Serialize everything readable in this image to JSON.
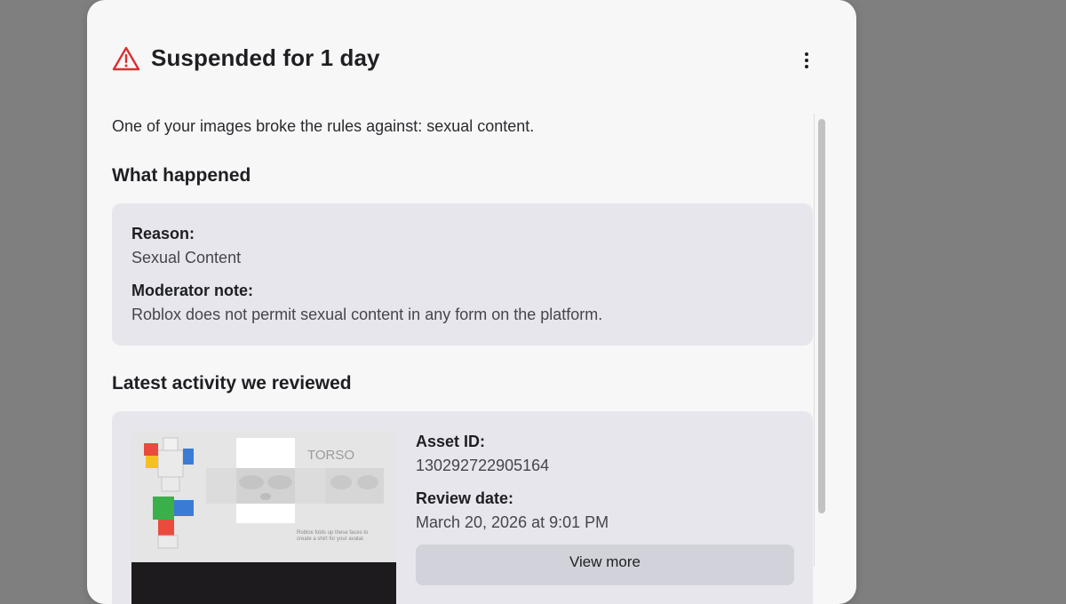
{
  "header": {
    "title": "Suspended for 1 day",
    "icon": "warning-triangle-icon",
    "icon_color": "#d93030",
    "menu_icon": "more-vertical-icon"
  },
  "intro": "One of your images broke the rules against: sexual content.",
  "what_happened": {
    "heading": "What happened",
    "reason_label": "Reason:",
    "reason_value": "Sexual Content",
    "note_label": "Moderator note:",
    "note_value": "Roblox does not permit sexual content in any form on the platform."
  },
  "latest": {
    "heading": "Latest activity we reviewed",
    "asset_id_label": "Asset ID:",
    "asset_id_value": "130292722905164",
    "review_date_label": "Review date:",
    "review_date_value": "March 20, 2026 at 9:01 PM",
    "view_more_label": "View more",
    "thumbnail": {
      "label": "TORSO",
      "caption_line1": "Roblox folds up these faces to",
      "caption_line2": "create a shirt for your avatar."
    }
  },
  "colors": {
    "backdrop": "#7f7f7f",
    "modal_bg": "#f7f7f8",
    "card_bg": "#e6e6ec",
    "button_bg": "#d2d3da",
    "warning": "#d93030"
  }
}
